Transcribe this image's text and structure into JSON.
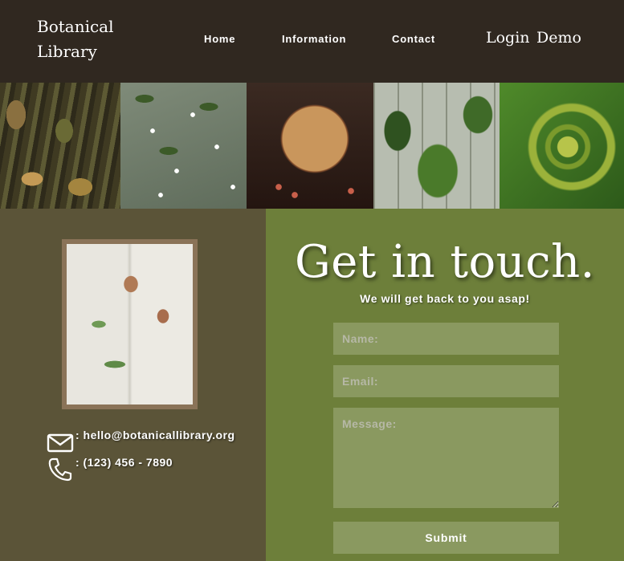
{
  "header": {
    "brand": "Botanical Library",
    "nav": {
      "home": "Home",
      "information": "Information",
      "contact": "Contact"
    },
    "auth": {
      "login": "Login",
      "demo": "Demo"
    }
  },
  "contact_info": {
    "email": ": hello@botanicallibrary.org",
    "phone": ": (123) 456 - 7890"
  },
  "form": {
    "title": "Get in touch.",
    "subtitle": "We will get back to you asap!",
    "name_placeholder": "Name:",
    "email_placeholder": "Email:",
    "message_placeholder": "Message:",
    "submit_label": "Submit"
  },
  "colors": {
    "header_bg": "#302820",
    "left_panel_bg": "#5b5438",
    "right_panel_bg": "#6d7f3a",
    "field_bg": "#8a9960"
  },
  "icons": [
    "mail-icon",
    "phone-icon"
  ]
}
